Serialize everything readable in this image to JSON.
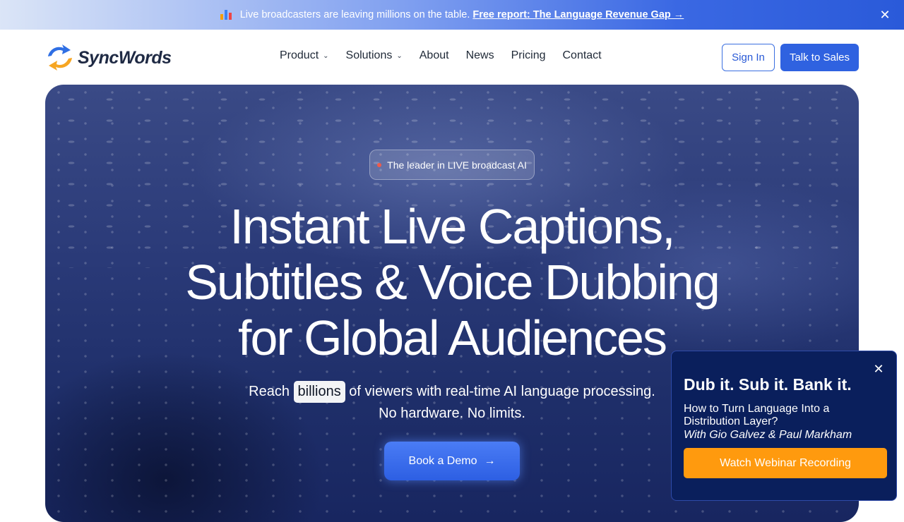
{
  "announcement": {
    "icon": "bar-chart-icon",
    "message": "Live broadcasters are leaving millions on the table.",
    "link": "Free report: The Language Revenue Gap →",
    "close_icon": "close-icon"
  },
  "nav": {
    "logo_text": "SyncWords",
    "items": [
      {
        "label": "Product",
        "dropdown": true
      },
      {
        "label": "Solutions",
        "dropdown": true
      },
      {
        "label": "About",
        "dropdown": false
      },
      {
        "label": "News",
        "dropdown": false
      },
      {
        "label": "Pricing",
        "dropdown": false
      },
      {
        "label": "Contact",
        "dropdown": false
      }
    ],
    "sign_in": "Sign In",
    "talk_to_sales": "Talk to Sales"
  },
  "hero": {
    "badge": "The leader in LIVE broadcast AI",
    "headline": [
      "Instant Live Captions,",
      "Subtitles & Voice Dubbing",
      "for Global Audiences"
    ],
    "sub_before": "Reach",
    "sub_highlight": "billions",
    "sub_after": "of viewers with real-time AI language processing.",
    "sub_line2": "No hardware. No limits.",
    "cta": "Book a Demo",
    "cta_icon": "arrow-right-icon"
  },
  "popup": {
    "title": "Dub it. Sub it. Bank it.",
    "line1": "How to Turn Language Into a Distribution Layer?",
    "line2": "With Gio Galvez & Paul Markham",
    "button": "Watch Webinar Recording",
    "close_icon": "close-icon"
  },
  "colors": {
    "accent": "#2f62e0",
    "popup_bg": "#0a1f5c",
    "popup_button": "#ff9a0e",
    "badge_dot": "#ef5b4b"
  }
}
